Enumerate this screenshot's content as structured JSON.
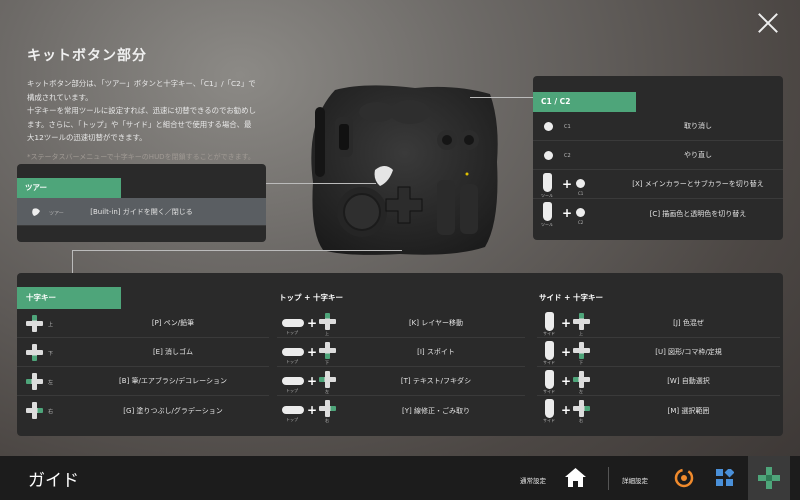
{
  "intro": {
    "title": "キットボタン部分",
    "body": "キットボタン部分は、「ツアー」ボタンと十字キー、「C1」/「C2」で\n構成されています。\n十字キーを常用ツールに設定すれば、迅速に切替できるのでお勧めし\nます。さらに、「トップ」や「サイド」と組合せで使用する場合、最\n大12ツールの迅速切替ができます。",
    "note": "*ステータスバーメニューで十字キーのHUDを閉鎖することができます。"
  },
  "tour_panel": {
    "header": "ツアー",
    "row": {
      "sub": "ツアー",
      "desc": "[Built-in] ガイドを開く／閉じる"
    }
  },
  "c_panel": {
    "header": "C1 / C2",
    "rows": [
      {
        "sub": "C1",
        "desc": "取り消し"
      },
      {
        "sub": "C2",
        "desc": "やり直し"
      },
      {
        "sub": "C1",
        "side_label": "ツール",
        "desc": "[X] メインカラーとサブカラーを切り替え"
      },
      {
        "sub": "C2",
        "side_label": "ツール",
        "desc": "[C] 描画色と透明色を切り替え"
      }
    ]
  },
  "dpad_col": {
    "title": "十字キー",
    "rows": [
      {
        "dir": "up",
        "sub": "上",
        "desc": "[P] ペン/鉛筆"
      },
      {
        "dir": "down",
        "sub": "下",
        "desc": "[E] 消しゴム"
      },
      {
        "dir": "left",
        "sub": "左",
        "desc": "[B] 筆/エアブラシ/デコレーション"
      },
      {
        "dir": "right",
        "sub": "右",
        "desc": "[G] 塗りつぶし/グラデーション"
      }
    ]
  },
  "top_col": {
    "title": "トップ + 十字キー",
    "top_label": "トップ",
    "rows": [
      {
        "dir": "up",
        "sub": "上",
        "desc": "[K] レイヤー移動"
      },
      {
        "dir": "down",
        "sub": "下",
        "desc": "[I] スポイト"
      },
      {
        "dir": "left",
        "sub": "左",
        "desc": "[T] テキスト/フキダシ"
      },
      {
        "dir": "right",
        "sub": "右",
        "desc": "[Y] 線修正・ごみ取り"
      }
    ]
  },
  "side_col": {
    "title": "サイド + 十字キー",
    "side_label": "サイド",
    "rows": [
      {
        "dir": "up",
        "sub": "上",
        "desc": "[J] 色混ぜ"
      },
      {
        "dir": "down",
        "sub": "下",
        "desc": "[U] 図形/コマ枠/定規"
      },
      {
        "dir": "left",
        "sub": "左",
        "desc": "[W] 自動選択"
      },
      {
        "dir": "right",
        "sub": "右",
        "desc": "[M] 選択範囲"
      }
    ]
  },
  "bottombar": {
    "title": "ガイド",
    "normal_settings": "通常設定",
    "detail_settings": "詳細設定"
  },
  "colors": {
    "accent": "#4ea57a",
    "panel": "#2a2a2a",
    "bar": "#1c1c1c"
  },
  "icons": [
    "close-icon",
    "home-icon",
    "dial-icon",
    "grid-icon",
    "dpad-icon"
  ]
}
